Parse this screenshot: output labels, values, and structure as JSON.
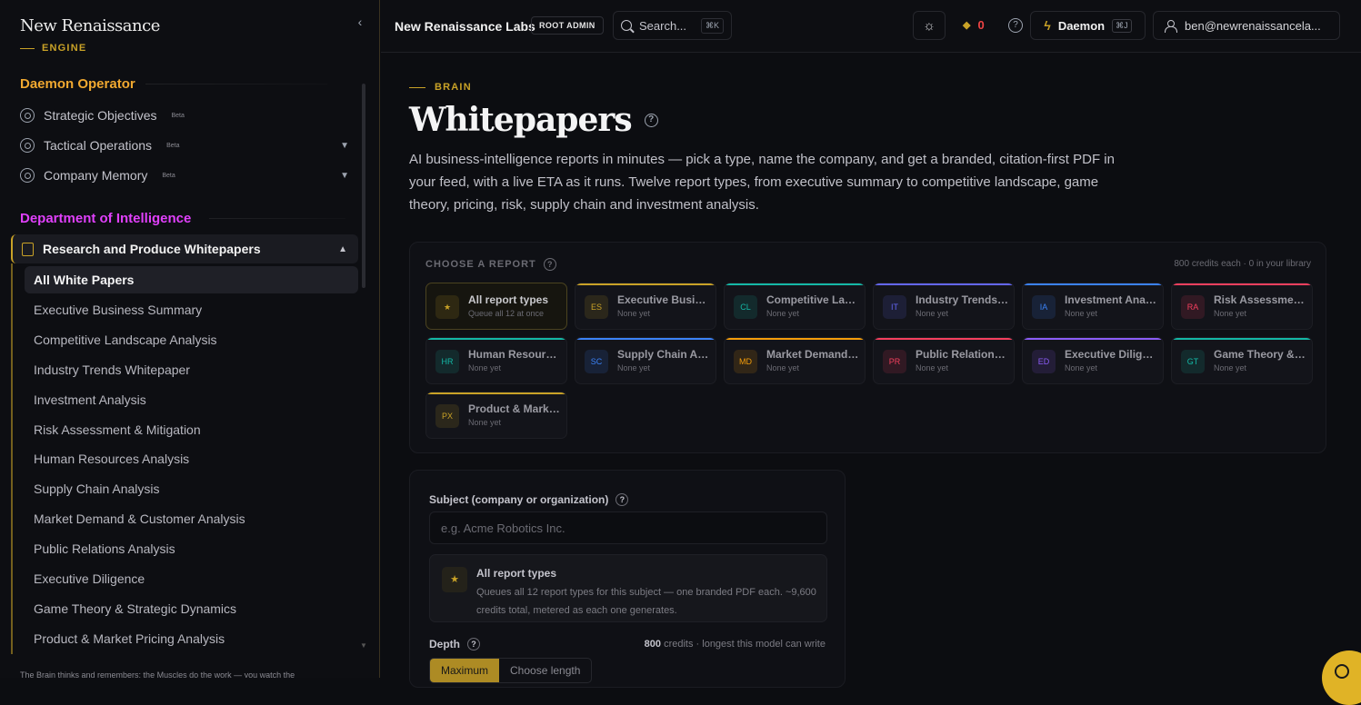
{
  "brand": {
    "title": "New Renaissance",
    "subtitle": "ENGINE"
  },
  "sidebar": {
    "section1_title": "Daemon Operator",
    "section1_color": "#f0a830",
    "section1_items": [
      {
        "label": "Strategic Objectives",
        "beta": "Beta"
      },
      {
        "label": "Tactical Operations",
        "beta": "Beta"
      },
      {
        "label": "Company Memory",
        "beta": "Beta"
      }
    ],
    "section2_title": "Department of Intelligence",
    "section2_color": "#e040fb",
    "group_label": "Research and Produce Whitepapers",
    "sub_items": [
      "All White Papers",
      "Executive Business Summary",
      "Competitive Landscape Analysis",
      "Industry Trends Whitepaper",
      "Investment Analysis",
      "Risk Assessment & Mitigation",
      "Human Resources Analysis",
      "Supply Chain Analysis",
      "Market Demand & Customer Analysis",
      "Public Relations Analysis",
      "Executive Diligence",
      "Game Theory & Strategic Dynamics",
      "Product & Market Pricing Analysis"
    ],
    "footer": "The Brain thinks and remembers; the Muscles do the work — you watch the"
  },
  "topbar": {
    "org": "New Renaissance Labs",
    "badge": "ROOT ADMIN",
    "search_label": "Search...",
    "search_kbd": "⌘K",
    "credits": "0",
    "daemon_label": "Daemon",
    "daemon_kbd": "⌘J",
    "user": "ben@newrenaissancela..."
  },
  "main": {
    "eyebrow": "BRAIN",
    "title": "Whitepapers",
    "intro": "AI business-intelligence reports in minutes — pick a type, name the company, and get a branded, citation-first PDF in your feed, with a live ETA as it runs. Twelve report types, from executive summary to competitive landscape, game theory, pricing, risk, supply chain and investment analysis.",
    "choose_label": "CHOOSE A REPORT",
    "choose_meta": "800 credits each · 0 in your library",
    "cards": [
      {
        "code": "★",
        "name": "All report types",
        "sub": "Queue all 12 at once",
        "color": "#c9a227"
      },
      {
        "code": "ES",
        "name": "Executive Business Summary",
        "sub": "None yet",
        "color": "#c9a227"
      },
      {
        "code": "CL",
        "name": "Competitive Landscape Analysis",
        "sub": "None yet",
        "color": "#14b8a6"
      },
      {
        "code": "IT",
        "name": "Industry Trends Whitepaper",
        "sub": "None yet",
        "color": "#6366f1"
      },
      {
        "code": "IA",
        "name": "Investment Analysis",
        "sub": "None yet",
        "color": "#3b82f6"
      },
      {
        "code": "RA",
        "name": "Risk Assessment & Mitigation",
        "sub": "None yet",
        "color": "#f43f5e"
      },
      {
        "code": "HR",
        "name": "Human Resources Analysis",
        "sub": "None yet",
        "color": "#14b8a6"
      },
      {
        "code": "SC",
        "name": "Supply Chain Analysis",
        "sub": "None yet",
        "color": "#3b82f6"
      },
      {
        "code": "MD",
        "name": "Market Demand & Customer Analysis",
        "sub": "None yet",
        "color": "#f59e0b"
      },
      {
        "code": "PR",
        "name": "Public Relations Analysis",
        "sub": "None yet",
        "color": "#f43f5e"
      },
      {
        "code": "ED",
        "name": "Executive Diligence",
        "sub": "None yet",
        "color": "#8b5cf6"
      },
      {
        "code": "GT",
        "name": "Game Theory & Strategic Dynamics",
        "sub": "None yet",
        "color": "#14b8a6"
      },
      {
        "code": "PX",
        "name": "Product & Market Pricing Analysis",
        "sub": "None yet",
        "color": "#c9a227"
      }
    ],
    "subject_label": "Subject (company or organization)",
    "subject_placeholder": "e.g. Acme Robotics Inc.",
    "all_title": "All report types",
    "all_desc": "Queues all 12 report types for this subject — one branded PDF each. ~9,600 credits total, metered as each one generates.",
    "depth_label": "Depth",
    "depth_credits": "800",
    "depth_meta_rest": "credits · longest this model can write",
    "depth_options": [
      "Maximum",
      "Choose length"
    ]
  }
}
